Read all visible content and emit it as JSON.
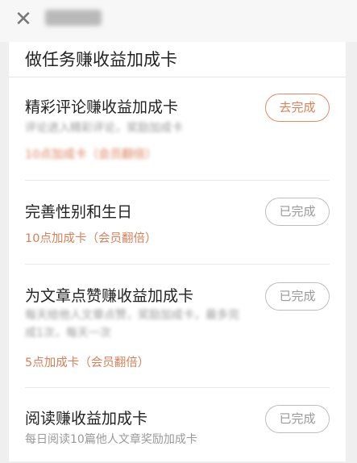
{
  "page": {
    "section_title": "做任务赚收益加成卡"
  },
  "tasks": [
    {
      "title": "精彩评论赚收益加成卡",
      "desc": [
        "评论进入精彩评论，奖励加成卡"
      ],
      "reward": "10点加成卡（会员翻倍）",
      "status": "去完成",
      "state": "active"
    },
    {
      "title": "完善性别和生日",
      "desc": [],
      "reward": "10点加成卡（会员翻倍）",
      "status": "已完成",
      "state": "done"
    },
    {
      "title": "为文章点赞赚收益加成卡",
      "desc": [
        "每天给他人文章点赞，奖励加成卡，最多完",
        "成1次，每天一次"
      ],
      "reward": "5点加成卡（会员翻倍）",
      "status": "已完成",
      "state": "done"
    },
    {
      "title": "阅读赚收益加成卡",
      "desc": [
        "每日阅读10篇他人文章奖励加成卡"
      ],
      "reward": "",
      "status": "已完成",
      "state": "done"
    }
  ],
  "colors": {
    "accent": "#d9805c",
    "muted": "#999999"
  },
  "icons": {
    "close": "close-icon"
  }
}
